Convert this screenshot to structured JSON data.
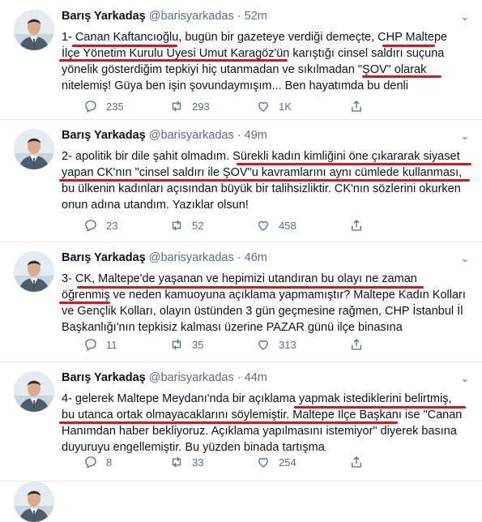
{
  "author": {
    "name": "Barış Yarkadaş",
    "handle": "@barisyarkadas",
    "separator": "·"
  },
  "tweets": [
    {
      "time": "52m",
      "lines": [
        "1- Canan Kaftancıoğlu, bugün bir gazeteye verdiği demeçte, CHP Maltepe",
        "İlçe Yönetim Kurulu Üyesi Umut Karagöz'ün karıştığı cinsel saldırı suçuna",
        "yönelik gösterdiğim tepkiyi hiç utanmadan ve sıkılmadan \"ŞOV\" olarak",
        "nitelemiş! Güya ben işin şovundaymışım... Ben hayatımda bu denli"
      ],
      "replies": "235",
      "retweets": "293",
      "likes": "1K"
    },
    {
      "time": "49m",
      "lines": [
        "2- apolitik bir dile şahit olmadım. Sürekli kadın kimliğini öne çıkararak siyaset",
        "yapan CK'nın \"cinsel saldırı ile ŞOV\"u kavramlarını aynı cümlede kullanması,",
        "bu ülkenin kadınları açısından büyük bir talihsizliktir. CK'nın sözlerini okurken",
        "onun adına utandım. Yazıklar olsun!"
      ],
      "replies": "23",
      "retweets": "52",
      "likes": "458"
    },
    {
      "time": "46m",
      "lines": [
        "3- CK, Maltepe'de yaşanan ve hepimizi utandıran bu olayı ne zaman",
        "öğrenmiş ve neden kamuoyuna açıklama yapmamıştır? Maltepe Kadın Kolları",
        "ve Gençlik Kolları, olayın üstünden 3 gün geçmesine rağmen, CHP İstanbul İl",
        "Başkanlığı'nın tepkisiz  kalması üzerine PAZAR günü ilçe binasına"
      ],
      "replies": "11",
      "retweets": "35",
      "likes": "313"
    },
    {
      "time": "44m",
      "lines": [
        "4- gelerek Maltepe Meydanı'nda bir açıklama yapmak istediklerini belirtmiş,",
        "bu utanca ortak olmayacaklarını söylemiştir. Maltepe İlçe Başkanı ise \"Canan",
        "Hanımdan haber bekliyoruz. Açıklama yapılmasını istemiyor\" diyerek basına",
        "duyuruyu engellemiştir. Bu yüzden binada tartışma"
      ],
      "replies": "8",
      "retweets": "33",
      "likes": "254"
    }
  ],
  "icons": {
    "reply": "reply-icon",
    "retweet": "retweet-icon",
    "like": "like-icon",
    "share": "share-icon",
    "more": "chevron-down-icon"
  },
  "colors": {
    "highlight": "#e0121a",
    "muted": "#5b7083",
    "text": "#0f1419"
  }
}
